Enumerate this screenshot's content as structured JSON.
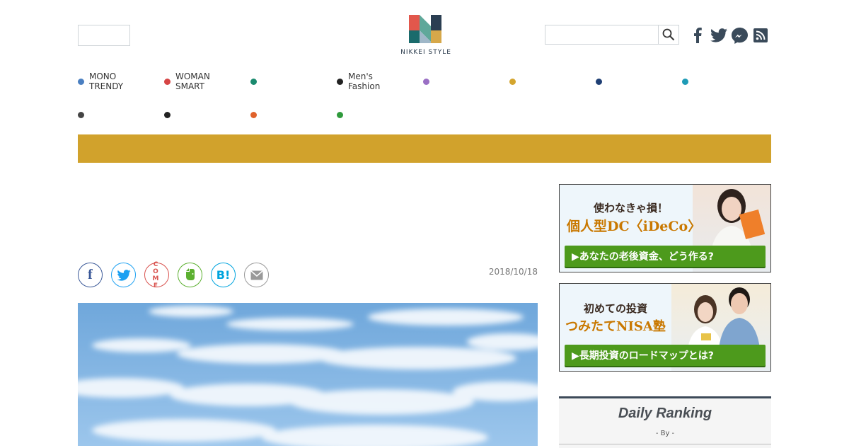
{
  "header": {
    "logo_text": "NIKKEI STYLE",
    "search": {
      "placeholder": "",
      "button_icon": "search-icon"
    },
    "social_icons": [
      "facebook-icon",
      "twitter-icon",
      "messenger-icon",
      "rss-icon"
    ]
  },
  "nav": {
    "items": [
      {
        "label": "MONO\nTRENDY",
        "color": "#4a7fc1"
      },
      {
        "label": "WOMAN\nSMART",
        "color": "#d64545"
      },
      {
        "label": "",
        "color": "#1a8a6e"
      },
      {
        "label": "Men's\nFashion",
        "color": "#222222"
      },
      {
        "label": "",
        "color": "#9a6fc4"
      },
      {
        "label": "",
        "color": "#d4a52e"
      },
      {
        "label": "",
        "color": "#1f3f74"
      },
      {
        "label": "",
        "color": "#1e9bb6"
      },
      {
        "label": "",
        "color": "#444444"
      },
      {
        "label": "",
        "color": "#222222"
      },
      {
        "label": "",
        "color": "#e0622b"
      },
      {
        "label": "",
        "color": "#2f9a3c"
      }
    ]
  },
  "colors": {
    "gold_bar": "#d1a22c",
    "ranking_border": "#3d4a59"
  },
  "article": {
    "date": "2018/10/18",
    "share_buttons": [
      {
        "name": "facebook-share",
        "label": "f",
        "color": "#3b5998"
      },
      {
        "name": "twitter-share",
        "label": "",
        "color": "#1da1f2"
      },
      {
        "name": "come-share",
        "label": "COME",
        "color": "#d9534f"
      },
      {
        "name": "evernote-share",
        "label": "",
        "color": "#5cb030"
      },
      {
        "name": "hatena-share",
        "label": "B!",
        "color": "#00a4de"
      },
      {
        "name": "mail-share",
        "label": "",
        "color": "#999999"
      }
    ]
  },
  "sidebar": {
    "ad1": {
      "headline1": "使わなきゃ損！",
      "headline2": "個人型DC〈iDeCo〉",
      "cta": "▶あなたの老後資金、どう作る?"
    },
    "ad2": {
      "headline1": "初めての投資",
      "headline2": "つみたてNISA塾",
      "cta": "▶長期投資のロードマップとは?"
    },
    "ranking": {
      "title": "Daily Ranking",
      "by": "- By  -"
    }
  }
}
